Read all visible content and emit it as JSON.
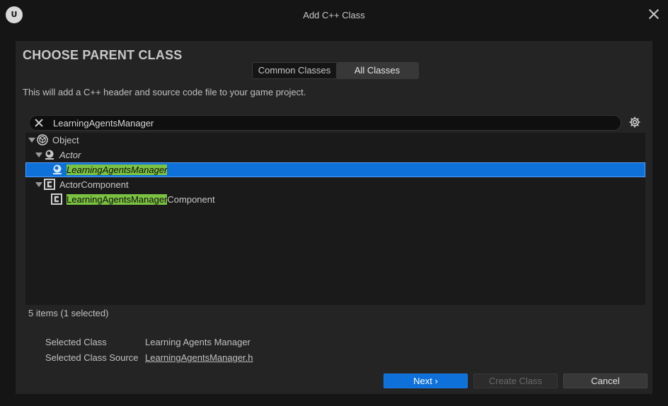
{
  "window": {
    "title": "Add C++ Class",
    "logo_text": "U"
  },
  "heading": "CHOOSE PARENT CLASS",
  "tabs": [
    {
      "label": "Common Classes",
      "active": false
    },
    {
      "label": "All Classes",
      "active": true
    }
  ],
  "description": "This will add a C++ header and source code file to your game project.",
  "search": {
    "value": "LearningAgentsManager"
  },
  "tree": {
    "rows": [
      {
        "label": "Object",
        "icon": "object-icon",
        "expanded": true
      },
      {
        "label": "Actor",
        "icon": "actor-icon",
        "expanded": true,
        "italic": true
      },
      {
        "label_highlight": "LearningAgentsManager",
        "label_rest": "",
        "icon": "actor-class-icon",
        "selected": true
      },
      {
        "label": "ActorComponent",
        "icon": "class-c-icon",
        "expanded": true
      },
      {
        "label_highlight": "LearningAgentsManager",
        "label_rest": "Component",
        "icon": "class-c-icon",
        "selected": false
      }
    ]
  },
  "status": "5 items (1 selected)",
  "selected_class": {
    "label": "Selected Class",
    "value": "Learning Agents Manager"
  },
  "selected_class_source": {
    "label": "Selected Class Source",
    "value": "LearningAgentsManager.h"
  },
  "buttons": {
    "next": "Next",
    "create": "Create Class",
    "cancel": "Cancel"
  },
  "colors": {
    "accent": "#0e70d9",
    "highlight": "#7cc242",
    "panel": "#242424",
    "background": "#151515"
  }
}
